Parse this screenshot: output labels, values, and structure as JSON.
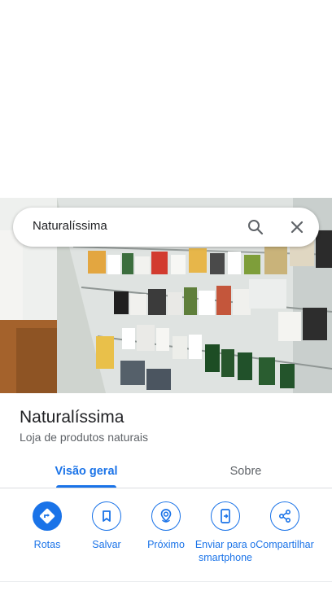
{
  "search": {
    "query": "Naturalíssima",
    "search_icon": "search-icon",
    "close_icon": "close-icon"
  },
  "place": {
    "title": "Naturalíssima",
    "category": "Loja de produtos naturais"
  },
  "tabs": [
    {
      "label": "Visão geral",
      "selected": true
    },
    {
      "label": "Sobre",
      "selected": false
    }
  ],
  "actions": [
    {
      "label": "Rotas",
      "icon": "directions-icon"
    },
    {
      "label": "Salvar",
      "icon": "bookmark-icon"
    },
    {
      "label": "Próximo",
      "icon": "nearby-icon"
    },
    {
      "label": "Enviar para o smartphone",
      "icon": "send-to-phone-icon"
    },
    {
      "label": "Compartilhar",
      "icon": "share-icon"
    }
  ],
  "colors": {
    "accent": "#1a73e8",
    "text_primary": "#202124",
    "text_secondary": "#5f6368"
  }
}
